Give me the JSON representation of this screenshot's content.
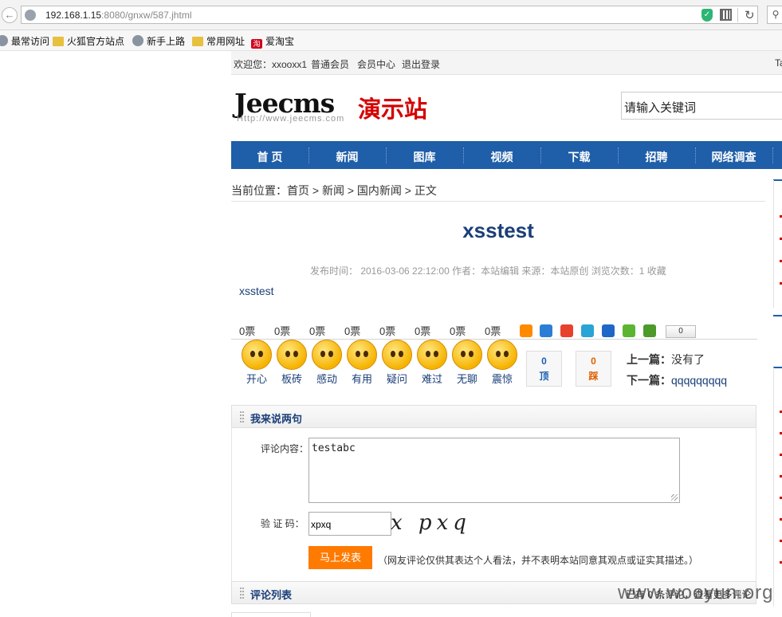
{
  "browser": {
    "url_host": "192.168.1.15",
    "url_rest": ":8080/gnxw/587.jhtml",
    "bookmarks": [
      "最常访问",
      "火狐官方站点",
      "新手上路",
      "常用网址",
      "爱淘宝"
    ]
  },
  "topbar": {
    "welcome": "欢迎您：xxooxx1",
    "member_type": "普通会员",
    "member_center": "会员中心",
    "logout": "退出登录",
    "right_fragment": "Ta"
  },
  "logo": {
    "brand": "Jeecms",
    "site_name": "演示站",
    "url": "Http://www.jeecms.com"
  },
  "search": {
    "placeholder": "请输入关键词"
  },
  "nav": [
    "首 页",
    "新闻",
    "图库",
    "视频",
    "下载",
    "招聘",
    "网络调查"
  ],
  "breadcrumb": "当前位置：首页 > 新闻 > 国内新闻 > 正文",
  "article": {
    "title": "xsstest",
    "meta": "发布时间： 2016-03-06 22:12:00   作者：本站编辑   来源：本站原创   浏览次数：1 收藏",
    "body": "xsstest"
  },
  "moods": [
    {
      "count": "0票",
      "label": "开心"
    },
    {
      "count": "0票",
      "label": "板砖"
    },
    {
      "count": "0票",
      "label": "感动"
    },
    {
      "count": "0票",
      "label": "有用"
    },
    {
      "count": "0票",
      "label": "疑问"
    },
    {
      "count": "0票",
      "label": "难过"
    },
    {
      "count": "0票",
      "label": "无聊"
    },
    {
      "count": "0票",
      "label": "震惊"
    }
  ],
  "share": {
    "count": "0",
    "colors": [
      "#ff8a00",
      "#2a7fd4",
      "#e8412c",
      "#2aa4d4",
      "#1f66c8",
      "#5cb531",
      "#4c9a2a"
    ]
  },
  "updown": {
    "up": {
      "count": "0",
      "label": "顶"
    },
    "down": {
      "count": "0",
      "label": "踩"
    }
  },
  "prevnext": {
    "prev_label": "上一篇：",
    "prev_value": "没有了",
    "next_label": "下一篇：",
    "next_value": "qqqqqqqqq"
  },
  "comment_form": {
    "section_title": "我来说两句",
    "content_label": "评论内容：",
    "content_value": "testabc",
    "captcha_label": "验 证 码：",
    "captcha_value": "xpxq",
    "captcha_image_text": "x pxq",
    "submit_label": "马上发表",
    "note": "（网友评论仅供其表达个人看法，并不表明本站同意其观点或证实其描述。）"
  },
  "comment_list": {
    "section_title": "评论列表",
    "right_text": "已有 0 条评论，查看更多评论"
  },
  "watermark": "www.wooyun.org"
}
